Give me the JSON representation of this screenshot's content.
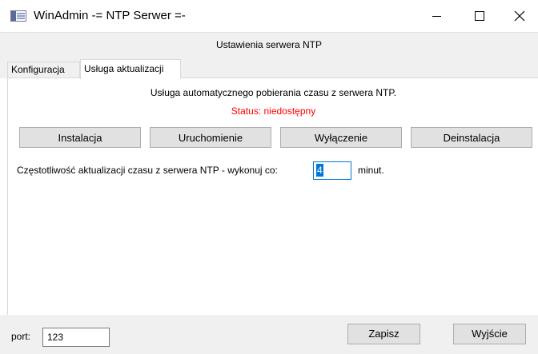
{
  "window": {
    "title": "WinAdmin -= NTP Serwer =-",
    "controls": {
      "minimize_icon": "minimize-icon",
      "maximize_icon": "maximize-icon",
      "close_icon": "close-icon",
      "close_glyph": "✕"
    }
  },
  "header": {
    "title": "Ustawienia serwera NTP"
  },
  "tabs": [
    {
      "label": "Konfiguracja",
      "active": false
    },
    {
      "label": "Usługa aktualizacji",
      "active": true
    }
  ],
  "service": {
    "description": "Usługa automatycznego pobierania czasu z serwera NTP.",
    "status": "Status: niedostępny",
    "status_color": "#ff0000",
    "buttons": [
      "Instalacja",
      "Uruchomienie",
      "Wyłączenie",
      "Deinstalacja"
    ]
  },
  "frequency": {
    "label": "Częstotliwość aktualizacji czasu z serwera NTP - wykonuj co:",
    "value": "4",
    "unit": "minut."
  },
  "footer": {
    "port_label": "port:",
    "port_value": "123",
    "save_label": "Zapisz",
    "exit_label": "Wyjście"
  },
  "colors": {
    "accent": "#0078d7",
    "panel_bg": "#f0f0f0",
    "button_bg": "#e1e1e1"
  }
}
